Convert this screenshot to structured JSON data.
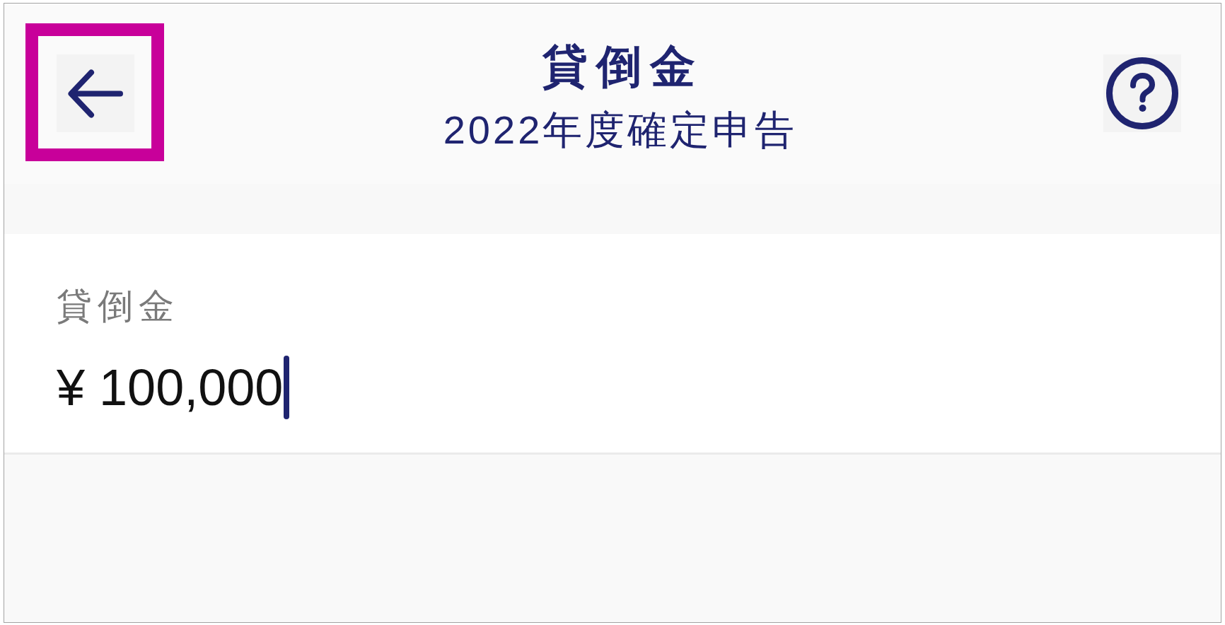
{
  "header": {
    "back_button": {
      "highlighted": true
    },
    "title": "貸倒金",
    "subtitle": "2022年度確定申告"
  },
  "field": {
    "label": "貸倒金",
    "value": "¥ 100,000",
    "focused": true
  }
}
